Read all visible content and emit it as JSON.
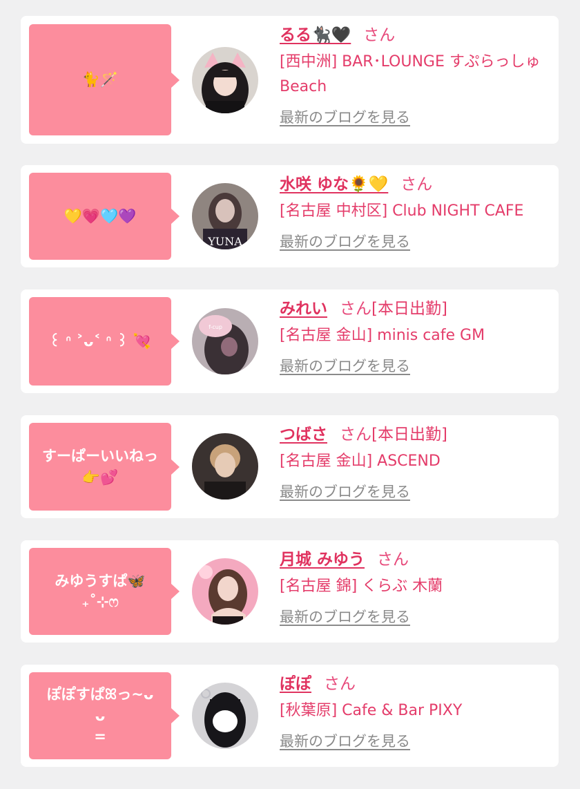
{
  "cards": [
    {
      "message": "🐈🪄",
      "name": "るる🐈‍⬛🖤",
      "honorific": "さん",
      "status": "",
      "shop": "[西中洲] BAR･LOUNGE すぷらっしゅBeach",
      "blog_link": "最新のブログを見る",
      "avatar_colors": {
        "bg": "#d9d4cf",
        "hair": "#1e1a1c",
        "face": "#f3dcd2",
        "accent": "#f4b4c4"
      }
    },
    {
      "message": "💛💗🩵💜",
      "name": "水咲 ゆな🌻💛",
      "honorific": "さん",
      "status": "",
      "shop": "[名古屋 中村区] Club NIGHT CAFE",
      "blog_link": "最新のブログを見る",
      "avatar_colors": {
        "bg": "#8f8580",
        "hair": "#4a3a3a",
        "face": "#d8c2bb",
        "accent": "#2b2330"
      },
      "avatar_caption": "YUNA"
    },
    {
      "message": "꒰ ᐢ ˃ᴗ˂ ᐢ ꒱ 💘",
      "name": "みれい",
      "honorific": "さん",
      "status": "[本日出勤]",
      "shop": "[名古屋 金山] minis cafe GM",
      "blog_link": "最新のブログを見る",
      "avatar_colors": {
        "bg": "#b9aeb3",
        "hair": "#3a3035",
        "face": "#f1c9d6",
        "accent": "#e8a5bf"
      }
    },
    {
      "message": "すーぱーいいねっ\n👉💕",
      "name": "つばさ",
      "honorific": "さん",
      "status": "[本日出勤]",
      "shop": "[名古屋 金山] ASCEND",
      "blog_link": "最新のブログを見る",
      "avatar_colors": {
        "bg": "#3a3230",
        "hair": "#c8a27a",
        "face": "#e6cbb6",
        "accent": "#1c1818"
      }
    },
    {
      "message": "みゆうすぱ🦋\n₊˚⊹ෆ",
      "name": "月城 みゆう",
      "honorific": "さん",
      "status": "",
      "shop": "[名古屋 錦] くらぶ 木蘭",
      "blog_link": "最新のブログを見る",
      "avatar_colors": {
        "bg": "#f4a9bf",
        "hair": "#5a3a30",
        "face": "#f2d6cc",
        "accent": "#ffd2de"
      }
    },
    {
      "message": "ぽぽすぱꕤっ~ᴗ\nᴗ\n=",
      "name": "ぽぽ",
      "honorific": "さん",
      "status": "",
      "shop": "[秋葉原] Cafe & Bar PIXY",
      "blog_link": "最新のブログを見る",
      "avatar_colors": {
        "bg": "#d4d3d6",
        "hair": "#17161a",
        "face": "#ffffff",
        "accent": "#bfbfc6"
      }
    }
  ]
}
